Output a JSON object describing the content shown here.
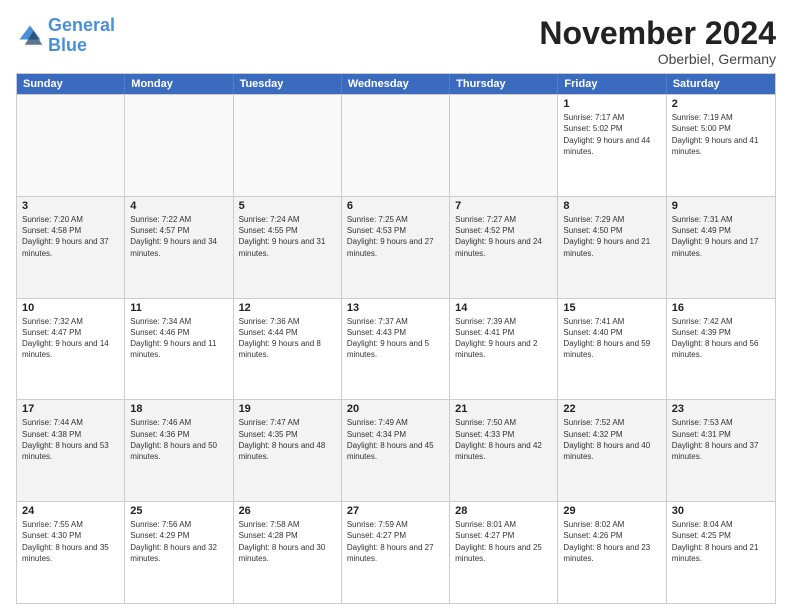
{
  "logo": {
    "line1": "General",
    "line2": "Blue"
  },
  "title": "November 2024",
  "subtitle": "Oberbiel, Germany",
  "header": {
    "days": [
      "Sunday",
      "Monday",
      "Tuesday",
      "Wednesday",
      "Thursday",
      "Friday",
      "Saturday"
    ]
  },
  "rows": [
    [
      {
        "day": "",
        "empty": true,
        "text": ""
      },
      {
        "day": "",
        "empty": true,
        "text": ""
      },
      {
        "day": "",
        "empty": true,
        "text": ""
      },
      {
        "day": "",
        "empty": true,
        "text": ""
      },
      {
        "day": "",
        "empty": true,
        "text": ""
      },
      {
        "day": "1",
        "text": "Sunrise: 7:17 AM\nSunset: 5:02 PM\nDaylight: 9 hours and 44 minutes."
      },
      {
        "day": "2",
        "text": "Sunrise: 7:19 AM\nSunset: 5:00 PM\nDaylight: 9 hours and 41 minutes."
      }
    ],
    [
      {
        "day": "3",
        "text": "Sunrise: 7:20 AM\nSunset: 4:58 PM\nDaylight: 9 hours and 37 minutes."
      },
      {
        "day": "4",
        "text": "Sunrise: 7:22 AM\nSunset: 4:57 PM\nDaylight: 9 hours and 34 minutes."
      },
      {
        "day": "5",
        "text": "Sunrise: 7:24 AM\nSunset: 4:55 PM\nDaylight: 9 hours and 31 minutes."
      },
      {
        "day": "6",
        "text": "Sunrise: 7:25 AM\nSunset: 4:53 PM\nDaylight: 9 hours and 27 minutes."
      },
      {
        "day": "7",
        "text": "Sunrise: 7:27 AM\nSunset: 4:52 PM\nDaylight: 9 hours and 24 minutes."
      },
      {
        "day": "8",
        "text": "Sunrise: 7:29 AM\nSunset: 4:50 PM\nDaylight: 9 hours and 21 minutes."
      },
      {
        "day": "9",
        "text": "Sunrise: 7:31 AM\nSunset: 4:49 PM\nDaylight: 9 hours and 17 minutes."
      }
    ],
    [
      {
        "day": "10",
        "text": "Sunrise: 7:32 AM\nSunset: 4:47 PM\nDaylight: 9 hours and 14 minutes."
      },
      {
        "day": "11",
        "text": "Sunrise: 7:34 AM\nSunset: 4:46 PM\nDaylight: 9 hours and 11 minutes."
      },
      {
        "day": "12",
        "text": "Sunrise: 7:36 AM\nSunset: 4:44 PM\nDaylight: 9 hours and 8 minutes."
      },
      {
        "day": "13",
        "text": "Sunrise: 7:37 AM\nSunset: 4:43 PM\nDaylight: 9 hours and 5 minutes."
      },
      {
        "day": "14",
        "text": "Sunrise: 7:39 AM\nSunset: 4:41 PM\nDaylight: 9 hours and 2 minutes."
      },
      {
        "day": "15",
        "text": "Sunrise: 7:41 AM\nSunset: 4:40 PM\nDaylight: 8 hours and 59 minutes."
      },
      {
        "day": "16",
        "text": "Sunrise: 7:42 AM\nSunset: 4:39 PM\nDaylight: 8 hours and 56 minutes."
      }
    ],
    [
      {
        "day": "17",
        "text": "Sunrise: 7:44 AM\nSunset: 4:38 PM\nDaylight: 8 hours and 53 minutes."
      },
      {
        "day": "18",
        "text": "Sunrise: 7:46 AM\nSunset: 4:36 PM\nDaylight: 8 hours and 50 minutes."
      },
      {
        "day": "19",
        "text": "Sunrise: 7:47 AM\nSunset: 4:35 PM\nDaylight: 8 hours and 48 minutes."
      },
      {
        "day": "20",
        "text": "Sunrise: 7:49 AM\nSunset: 4:34 PM\nDaylight: 8 hours and 45 minutes."
      },
      {
        "day": "21",
        "text": "Sunrise: 7:50 AM\nSunset: 4:33 PM\nDaylight: 8 hours and 42 minutes."
      },
      {
        "day": "22",
        "text": "Sunrise: 7:52 AM\nSunset: 4:32 PM\nDaylight: 8 hours and 40 minutes."
      },
      {
        "day": "23",
        "text": "Sunrise: 7:53 AM\nSunset: 4:31 PM\nDaylight: 8 hours and 37 minutes."
      }
    ],
    [
      {
        "day": "24",
        "text": "Sunrise: 7:55 AM\nSunset: 4:30 PM\nDaylight: 8 hours and 35 minutes."
      },
      {
        "day": "25",
        "text": "Sunrise: 7:56 AM\nSunset: 4:29 PM\nDaylight: 8 hours and 32 minutes."
      },
      {
        "day": "26",
        "text": "Sunrise: 7:58 AM\nSunset: 4:28 PM\nDaylight: 8 hours and 30 minutes."
      },
      {
        "day": "27",
        "text": "Sunrise: 7:59 AM\nSunset: 4:27 PM\nDaylight: 8 hours and 27 minutes."
      },
      {
        "day": "28",
        "text": "Sunrise: 8:01 AM\nSunset: 4:27 PM\nDaylight: 8 hours and 25 minutes."
      },
      {
        "day": "29",
        "text": "Sunrise: 8:02 AM\nSunset: 4:26 PM\nDaylight: 8 hours and 23 minutes."
      },
      {
        "day": "30",
        "text": "Sunrise: 8:04 AM\nSunset: 4:25 PM\nDaylight: 8 hours and 21 minutes."
      }
    ]
  ]
}
